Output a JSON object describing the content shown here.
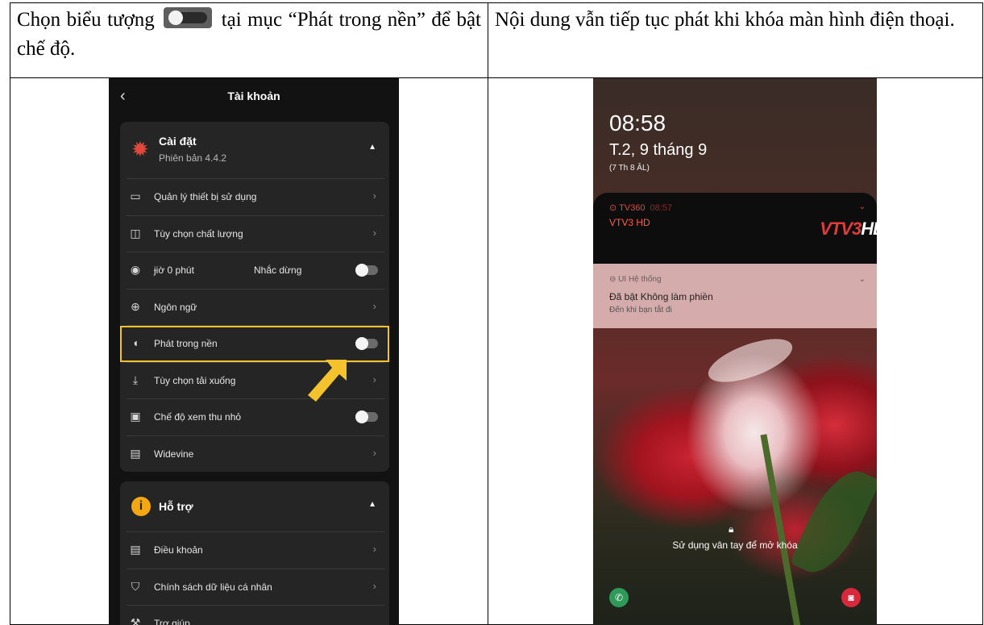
{
  "cells": {
    "left_instruction_before": "Chọn biểu tượng",
    "left_instruction_after": "tại mục “Phát trong nền” để bật chế độ.",
    "right_instruction": "Nội dung vẫn tiếp tục phát khi khóa màn hình điện thoại."
  },
  "phone1": {
    "header_title": "Tài khoản",
    "settings": {
      "title": "Cài đặt",
      "version": "Phiên bản 4.4.2",
      "items": [
        {
          "label": "Quản lý thiết bị sử dụng",
          "control": "chevron"
        },
        {
          "label": "Tùy chọn chất lượng",
          "control": "chevron"
        },
        {
          "label": "ɉiờ 0 phút",
          "label2": "Nhắc dừng",
          "control": "switch"
        },
        {
          "label": "Ngôn ngữ",
          "control": "chevron"
        },
        {
          "label": "Phát trong nền",
          "control": "switch",
          "highlighted": true
        },
        {
          "label": "Tùy chọn tải xuống",
          "control": "chevron"
        },
        {
          "label": "Chế độ xem thu nhỏ",
          "control": "switch"
        },
        {
          "label": "Widevine",
          "control": "chevron"
        }
      ]
    },
    "support": {
      "title": "Hỗ trợ",
      "items": [
        {
          "label": "Điều khoản",
          "control": "chevron"
        },
        {
          "label": "Chính sách dữ liệu cá nhân",
          "control": "chevron"
        },
        {
          "label": "Trợ giúp",
          "control": "none"
        }
      ]
    },
    "colors": {
      "accent": "#f3c22c",
      "gear": "#e0483b",
      "info": "#f3a712"
    }
  },
  "phone2": {
    "time": "08:58",
    "date": "T.2, 9 tháng 9",
    "lunar": "(7 Th 8 ÂL)",
    "notif_media": {
      "app": "TV360",
      "time": "08:57",
      "title": "VTV3 HD",
      "logo": "VTV3",
      "logo_suffix": "HD"
    },
    "notif_system": {
      "app": "UI Hệ thống",
      "title": "Đã bật Không làm phiền",
      "subtitle": "Đến khi bạn tắt đi"
    },
    "unlock_hint": "Sử dụng vân tay để mở khóa"
  }
}
